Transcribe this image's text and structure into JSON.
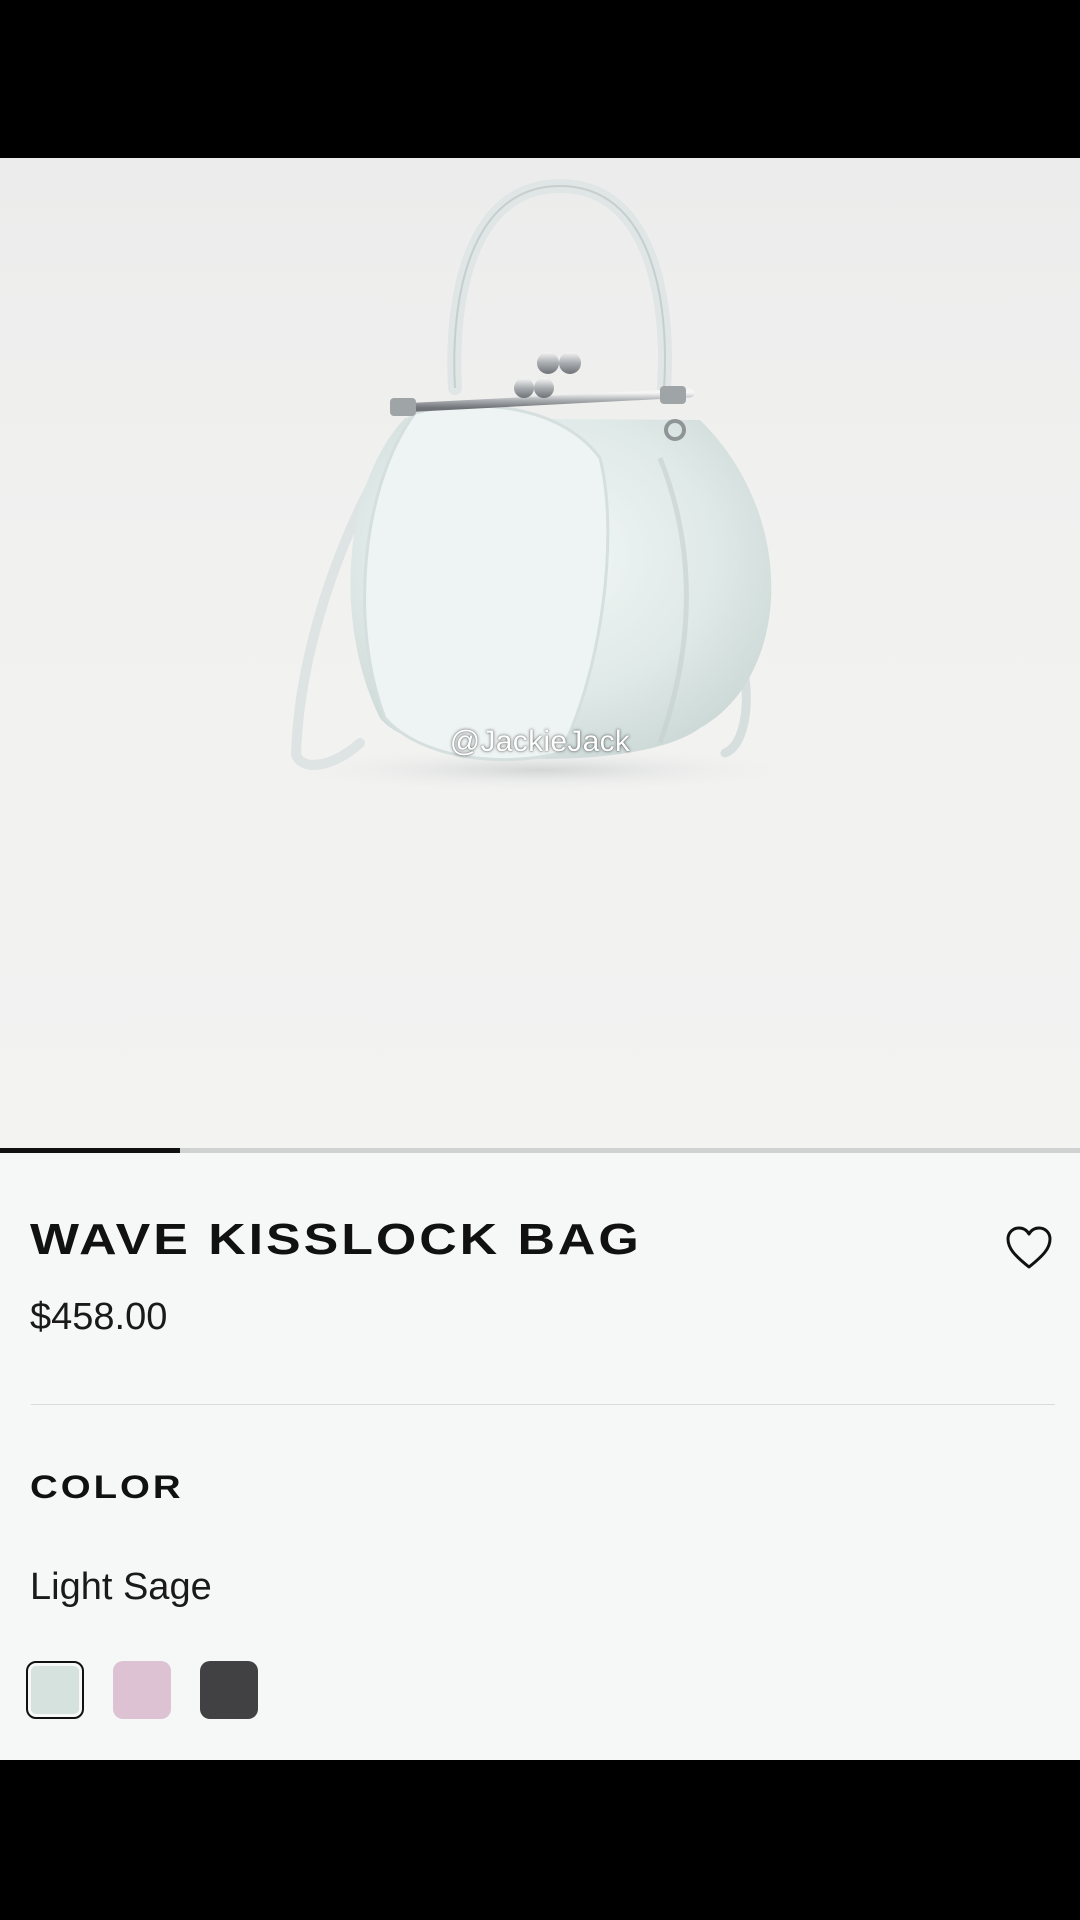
{
  "product": {
    "title": "WAVE KISSLOCK BAG",
    "price": "$458.00",
    "image_watermark": "@JackieJack",
    "gallery_progress": 0.167,
    "favorite_icon": "heart-outline-icon"
  },
  "color": {
    "heading": "COLOR",
    "selected_name": "Light Sage",
    "swatches": [
      {
        "color": "#d6e2de",
        "selected": true
      },
      {
        "color": "#dcc2d3",
        "selected": false
      },
      {
        "color": "#414144",
        "selected": false
      }
    ]
  }
}
